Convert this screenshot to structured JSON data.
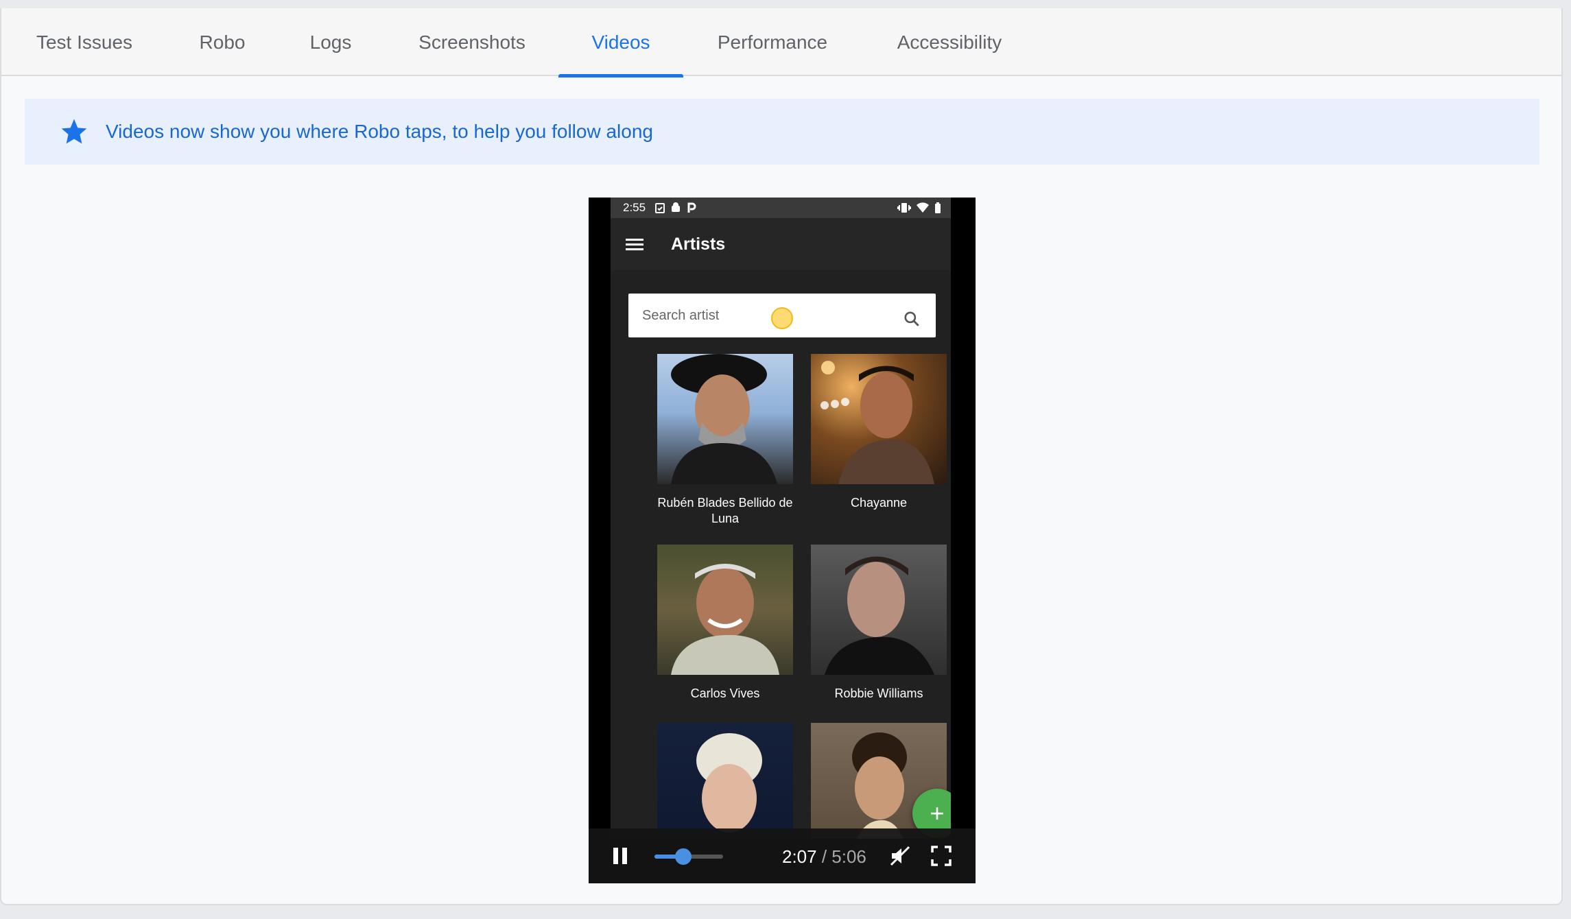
{
  "tabs": [
    {
      "label": "Test Issues",
      "active": false
    },
    {
      "label": "Robo",
      "active": false
    },
    {
      "label": "Logs",
      "active": false
    },
    {
      "label": "Screenshots",
      "active": false
    },
    {
      "label": "Videos",
      "active": true
    },
    {
      "label": "Performance",
      "active": false
    },
    {
      "label": "Accessibility",
      "active": false
    }
  ],
  "banner": {
    "icon": "star-icon",
    "text": "Videos now show you where Robo taps, to help you follow along"
  },
  "video": {
    "status_bar": {
      "time": "2:55"
    },
    "app": {
      "title": "Artists",
      "search_placeholder": "Search artist"
    },
    "artists": [
      {
        "name": "Rubén Blades Bellido de Luna"
      },
      {
        "name": "Chayanne"
      },
      {
        "name": "Carlos Vives"
      },
      {
        "name": "Robbie Williams"
      }
    ],
    "fab_label": "+",
    "player": {
      "current_time": "2:07",
      "separator": " / ",
      "duration": "5:06",
      "progress": 0.415
    }
  },
  "colors": {
    "accent": "#1a73e8",
    "banner_bg": "#e8f0fe",
    "fab": "#4caf50",
    "tap_indicator": "#fdd663"
  }
}
